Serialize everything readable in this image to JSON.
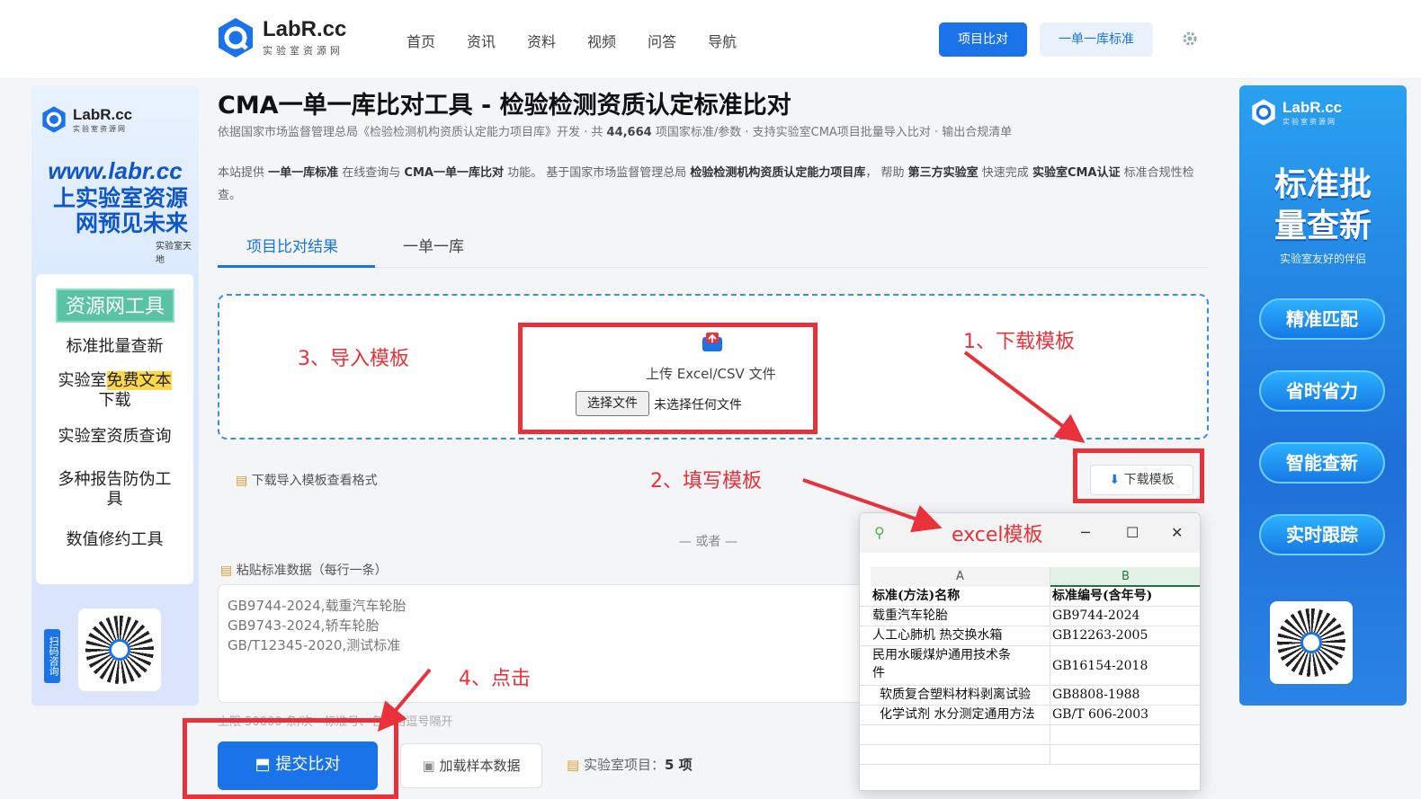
{
  "header": {
    "logo_name": "LabR.cc",
    "logo_sub": "实验室资源网",
    "nav": [
      "首页",
      "资讯",
      "资料",
      "视频",
      "问答",
      "导航"
    ],
    "btn_compare": "项目比对",
    "btn_standard": "一单一库标准",
    "accent": "#1a73e8"
  },
  "left_ad": {
    "logo_name": "LabR.cc",
    "logo_sub": "实验室资源网",
    "url": "www.labr.cc",
    "slogan_1": "上实验室资源",
    "slogan_2": "网预见未来",
    "tag": "实验室天地",
    "panel_title": "资源网工具",
    "items": [
      "标准批量查新",
      "实验室",
      "免费文本",
      "下载",
      "实验室资质查询",
      "多种报告防伪工",
      "具",
      "数值修约工具"
    ],
    "qr_side": "扫码咨询"
  },
  "right_ad": {
    "logo_name": "LabR.cc",
    "logo_sub": "实验室资源网",
    "big_1": "标准批",
    "big_2": "量查新",
    "small": "实验室友好的伴侣",
    "buttons": [
      "精准匹配",
      "省时省力",
      "智能查新",
      "实时跟踪"
    ]
  },
  "main": {
    "title": "CMA一单一库比对工具 - 检验检测资质认定标准比对",
    "sub_pre": "依据国家市场监督管理总局《检验检测机构资质认定能力项目库》开发 · 共 ",
    "sub_count": "44,664",
    "sub_post": " 项国家标准/参数 · 支持实验室CMA项目批量导入比对 · 输出合规清单",
    "desc_1": "本站提供 ",
    "desc_b1": "一单一库标准",
    "desc_2": " 在线查询与 ",
    "desc_b2": "CMA一单一库比对",
    "desc_3": " 功能。 基于国家市场监督管理总局 ",
    "desc_b3": "检验检测机构资质认定能力项目库",
    "desc_4": "， 帮助 ",
    "desc_b4": "第三方实验室",
    "desc_5": " 快速完成 ",
    "desc_b5": "实验室CMA认证",
    "desc_6": " 标准合规性检查。",
    "tabs": [
      "项目比对结果",
      "一单一库"
    ],
    "upload_label": "上传 Excel/CSV 文件",
    "file_button": "选择文件",
    "file_none": "未选择任何文件",
    "template_link": "下载导入模板查看格式",
    "template_button": "下载模板",
    "or": "— 或者 —",
    "paste_label": "粘贴标准数据（每行一条）",
    "paste_lines": [
      "GB9744-2024,载重汽车轮胎",
      "GB9743-2024,轿车轮胎",
      "GB/T12345-2020,测试标准"
    ],
    "hint": "上限 50000 条/次 · 标准号、名称用逗号隔开",
    "submit": "提交比对",
    "sample": "加载样本数据",
    "count_label": "实验室项目：",
    "count_value": "5 项"
  },
  "annotations": {
    "a1": "1、下载模板",
    "a2": "2、填写模板",
    "a3": "3、导入模板",
    "a4": "4、点击",
    "color": "#e8313a"
  },
  "excel": {
    "title": "excel模板",
    "col_a": "A",
    "col_b": "B",
    "header_a": "标准(方法)名称",
    "header_b": "标准编号(含年号)",
    "rows": [
      [
        "载重汽车轮胎",
        "GB9744-2024"
      ],
      [
        "人工心肺机 热交换水箱",
        "GB12263-2005"
      ],
      [
        "民用水暖煤炉通用技术条",
        "GB16154-2018"
      ],
      [
        "件",
        ""
      ],
      [
        "软质复合塑料材料剥离试验",
        "GB8808-1988"
      ],
      [
        "化学试剂 水分测定通用方法",
        "GB/T 606-2003"
      ]
    ]
  }
}
